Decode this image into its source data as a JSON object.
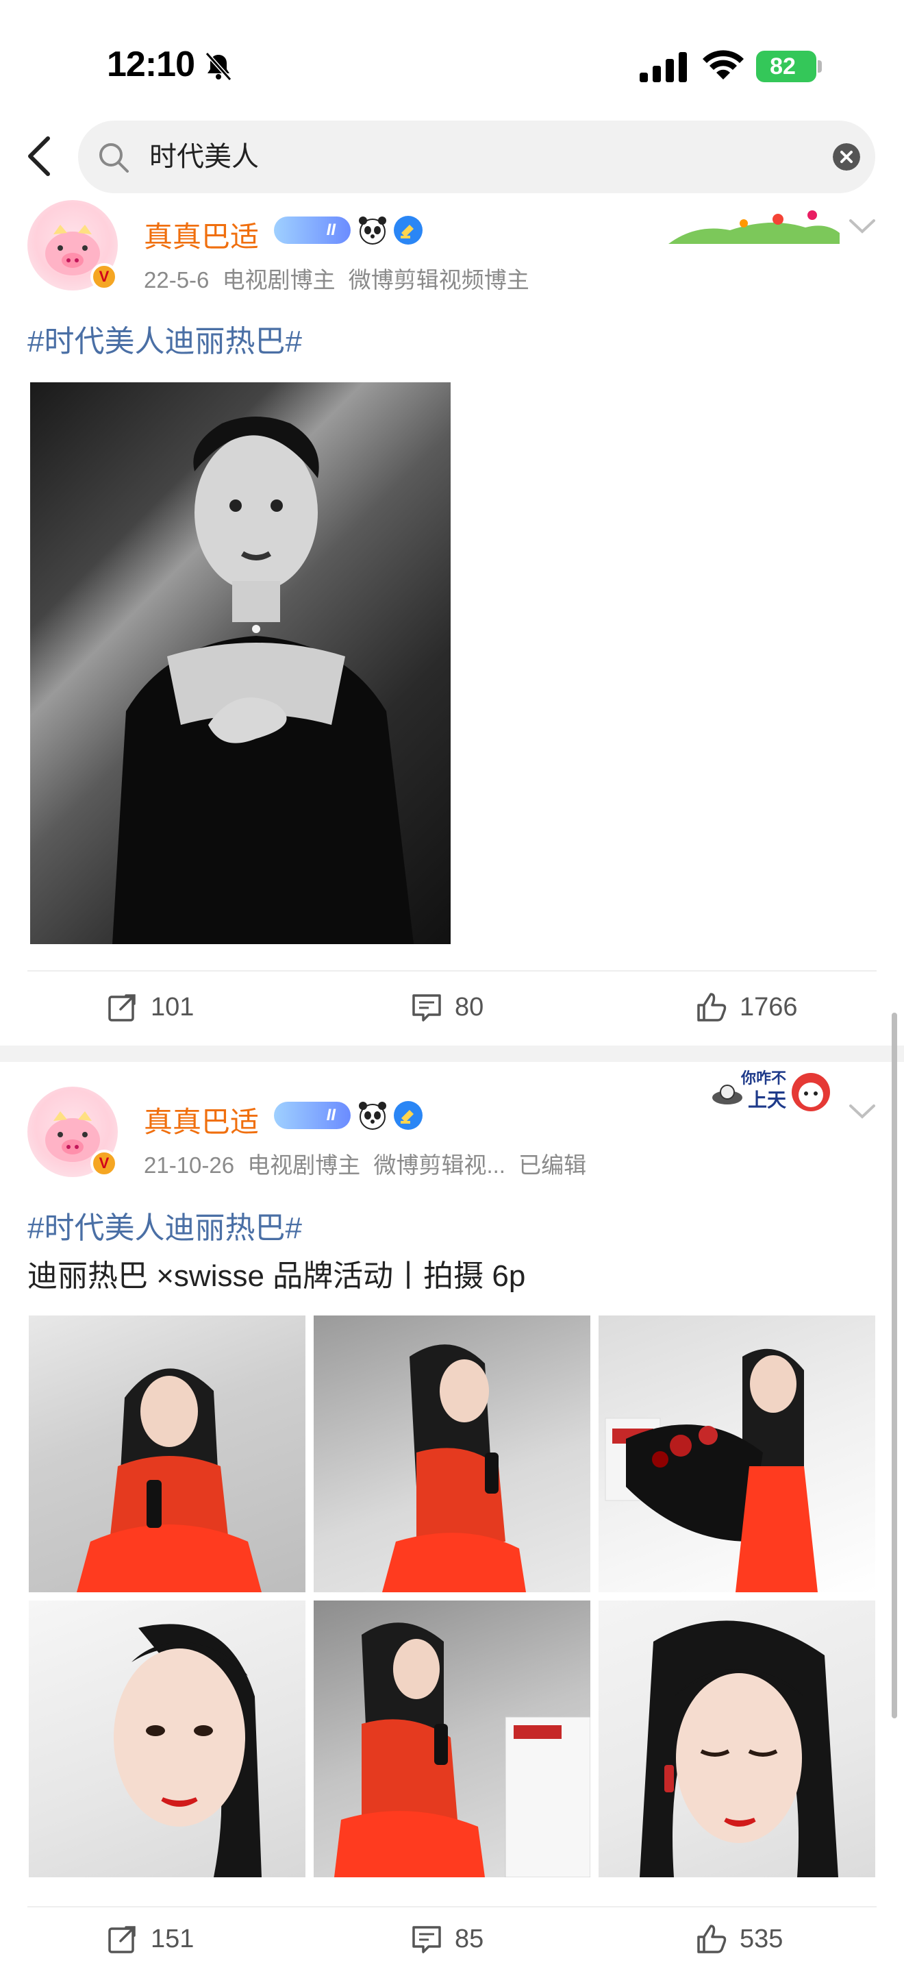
{
  "status_bar": {
    "time": "12:10",
    "battery": "82"
  },
  "search": {
    "query": "时代美人"
  },
  "posts": [
    {
      "user_name": "真真巴适",
      "level": "II",
      "date": "22-5-6",
      "tags": [
        "电视剧博主",
        "微博剪辑视频博主"
      ],
      "edited": "",
      "topic": "#时代美人迪丽热巴#",
      "text": "",
      "reposts": "101",
      "comments": "80",
      "likes": "1766"
    },
    {
      "user_name": "真真巴适",
      "level": "II",
      "date": "21-10-26",
      "tags": [
        "电视剧博主",
        "微博剪辑视..."
      ],
      "edited": "已编辑",
      "topic": "#时代美人迪丽热巴#",
      "text": "迪丽热巴 ×swisse 品牌活动丨拍摄 6p",
      "reposts": "151",
      "comments": "85",
      "likes": "535"
    }
  ],
  "decorations": {
    "badge_text_1": "你咋不",
    "badge_text_2": "上天"
  },
  "colors": {
    "username": "#f06f0e",
    "topic": "#4a6fa5",
    "battery": "#34c759"
  }
}
